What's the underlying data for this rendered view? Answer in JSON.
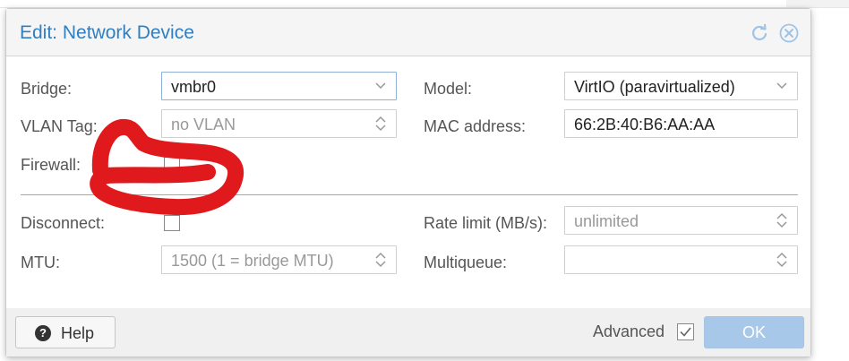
{
  "dialog": {
    "title": "Edit: Network Device",
    "reset_icon": "reset-icon",
    "close_icon": "close-icon"
  },
  "left": {
    "bridge": {
      "label": "Bridge:",
      "value": "vmbr0"
    },
    "vlan_tag": {
      "label": "VLAN Tag:",
      "placeholder": "no VLAN"
    },
    "firewall": {
      "label": "Firewall:",
      "checked": false
    },
    "disconnect": {
      "label": "Disconnect:",
      "checked": false
    },
    "mtu": {
      "label": "MTU:",
      "placeholder": "1500 (1 = bridge MTU)"
    }
  },
  "right": {
    "model": {
      "label": "Model:",
      "value": "VirtIO (paravirtualized)"
    },
    "mac_address": {
      "label": "MAC address:",
      "value": "66:2B:40:B6:AA:AA"
    },
    "rate_limit": {
      "label": "Rate limit (MB/s):",
      "placeholder": "unlimited"
    },
    "multiqueue": {
      "label": "Multiqueue:",
      "value": ""
    }
  },
  "footer": {
    "help_label": "Help",
    "advanced_label": "Advanced",
    "advanced_checked": true,
    "ok_label": "OK"
  },
  "annotation": {
    "color": "#e0191c",
    "shape": "red hand-drawn circle around firewall checkbox"
  }
}
